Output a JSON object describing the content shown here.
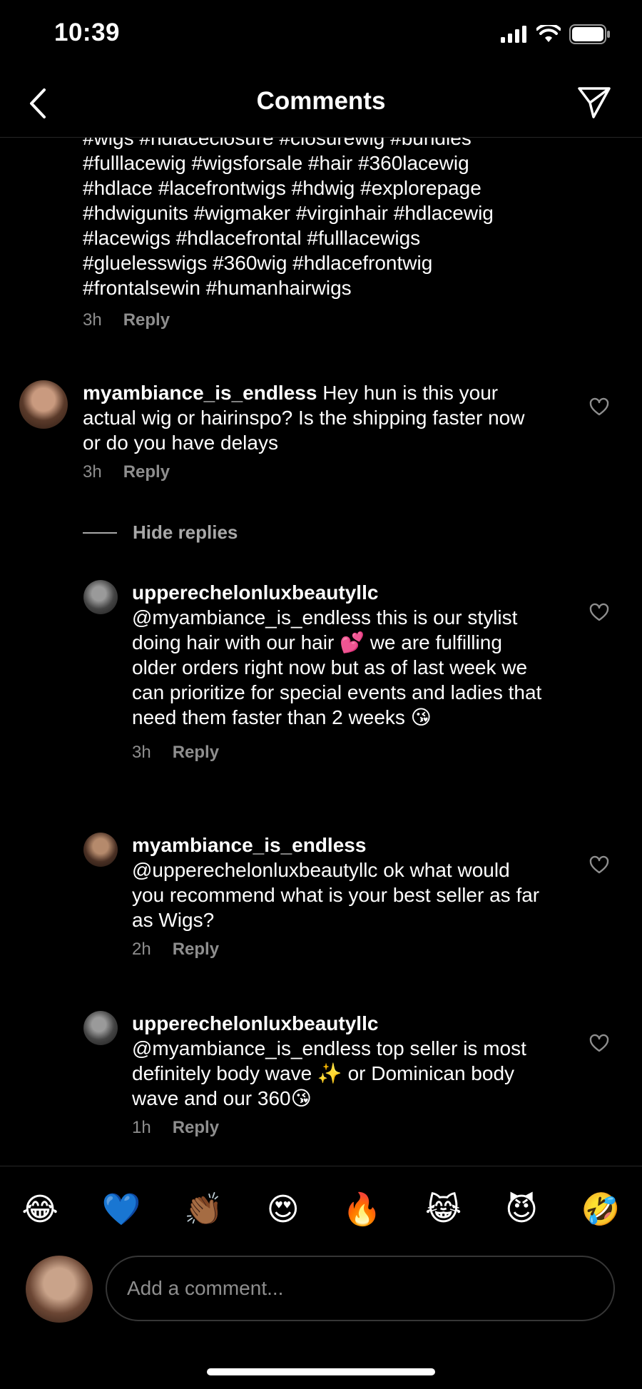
{
  "status_bar": {
    "time": "10:39"
  },
  "header": {
    "title": "Comments"
  },
  "caption": {
    "lines": [
      "#wigs #hdlaceclosure #closurewig #bundles",
      "#fulllacewig #wigsforsale #hair #360lacewig",
      "#hdlace #lacefrontwigs #hdwig #explorepage",
      "#hdwigunits #wigmaker #virginhair #hdlacewig",
      "#lacewigs #hdlacefrontal #fulllacewigs",
      "#gluelesswigs #360wig #hdlacefrontwig",
      "#frontalsewin #humanhairwigs"
    ],
    "time": "3h",
    "reply_label": "Reply"
  },
  "comments": [
    {
      "username": "myambiance_is_endless",
      "text": "Hey hun is this your actual wig or hairinspo? Is the shipping faster now or do you have delays",
      "time": "3h",
      "reply_label": "Reply"
    }
  ],
  "hide_replies_label": "Hide replies",
  "replies": [
    {
      "username": "upperechelonluxbeautyllc",
      "text": "@myambiance_is_endless this is our stylist doing hair with our hair 💕 we are fulfilling older orders right now but as of last week we can prioritize for special events and ladies that need them faster than 2 weeks 😘",
      "time": "3h",
      "reply_label": "Reply"
    },
    {
      "username": "myambiance_is_endless",
      "text": "@upperechelonluxbeautyllc ok what would you recommend what is your best seller as far as Wigs?",
      "time": "2h",
      "reply_label": "Reply"
    },
    {
      "username": "upperechelonluxbeautyllc",
      "text": "@myambiance_is_endless top seller is most definitely body wave ✨ or Dominican body wave and our 360😘",
      "time": "1h",
      "reply_label": "Reply"
    }
  ],
  "quick_emojis": [
    "😂",
    "💙",
    "👏🏾",
    "😍",
    "🔥",
    "😹",
    "😈",
    "🤣"
  ],
  "composer": {
    "placeholder": "Add a comment..."
  },
  "colors": {
    "background": "#000000",
    "text": "#ffffff",
    "muted": "#8e8e8e",
    "divider": "#262626"
  }
}
